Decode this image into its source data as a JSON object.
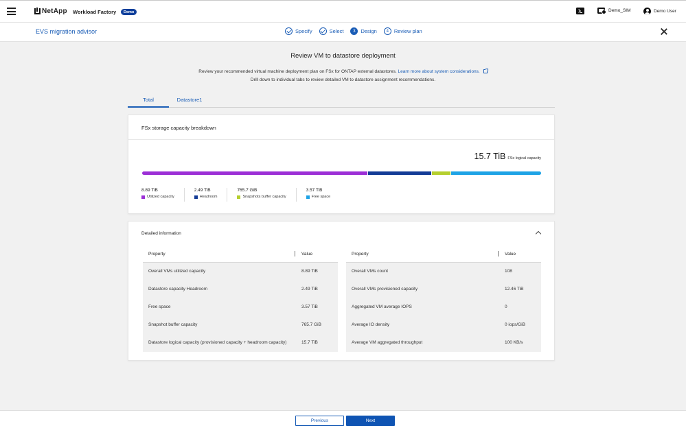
{
  "header": {
    "logo": "NetApp",
    "product": "Workload Factory",
    "badge": "Demo",
    "workspace": "Demo_SIM",
    "user": "Demo User"
  },
  "wizard": {
    "title": "EVS migration advisor",
    "steps": [
      {
        "label": "Specify",
        "state": "done"
      },
      {
        "label": "Select",
        "state": "done"
      },
      {
        "label": "Design",
        "number": "3",
        "state": "active"
      },
      {
        "label": "Review plan",
        "number": "4",
        "state": "upcoming"
      }
    ]
  },
  "page": {
    "title": "Review VM to datastore deployment",
    "desc_line1": "Review your recommended virtual machine deployment plan on FSx for ONTAP external datastores.",
    "desc_link": "Learn more about system considerations.",
    "desc_line2": "Drill down to individual tabs to review detailed VM to datastore assignment recommendations."
  },
  "tabs": [
    {
      "label": "Total",
      "active": true
    },
    {
      "label": "Datastore1",
      "active": false
    }
  ],
  "breakdown": {
    "title": "FSx storage capacity breakdown",
    "total_value": "15.7 TiB",
    "total_label": "FSx logical capacity",
    "segments": [
      {
        "value": "8.89 TiB",
        "label": "Utilized capacity",
        "color": "#9c2fd6",
        "share": 0.566
      },
      {
        "value": "2.49 TiB",
        "label": "Headroom",
        "color": "#143c96",
        "share": 0.159
      },
      {
        "value": "765.7 GiB",
        "label": "Snapshots buffer capacity",
        "color": "#b5cf2e",
        "share": 0.048
      },
      {
        "value": "3.57 TiB",
        "label": "Free space",
        "color": "#1ea3e6",
        "share": 0.227
      }
    ]
  },
  "details": {
    "title": "Detailed information",
    "col_property": "Property",
    "col_value": "Value",
    "left_rows": [
      {
        "property": "Overall VMs utilized capacity",
        "value": "8.89 TiB"
      },
      {
        "property": "Datastore capacity Headroom",
        "value": "2.49 TiB"
      },
      {
        "property": "Free space",
        "value": "3.57 TiB"
      },
      {
        "property": "Snapshot buffer capacity",
        "value": "765.7 GiB"
      },
      {
        "property": "Datastore logical capacity (provisioned capacity + headroom capacity)",
        "value": "15.7 TiB"
      }
    ],
    "right_rows": [
      {
        "property": "Overall VMs count",
        "value": "108"
      },
      {
        "property": "Overall VMs provisioned capacity",
        "value": "12.46 TiB"
      },
      {
        "property": "Aggregated VM average IOPS",
        "value": "0"
      },
      {
        "property": "Average IO density",
        "value": "0 iops/GiB"
      },
      {
        "property": "Average VM aggregated throughput",
        "value": "100 KB/s"
      }
    ]
  },
  "footer": {
    "previous": "Previous",
    "next": "Next"
  }
}
